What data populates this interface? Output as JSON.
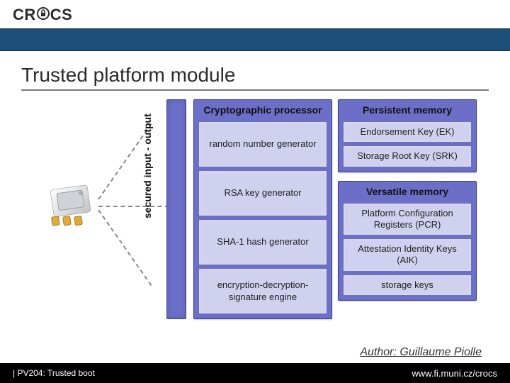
{
  "header": {
    "logo_text": "CRoCS"
  },
  "title": "Trusted platform module",
  "diagram": {
    "io_label": "secured input - output",
    "crypto_processor": {
      "label": "Cryptographic processor",
      "items": [
        "random number generator",
        "RSA key generator",
        "SHA-1 hash generator",
        "encryption-decryption-signature engine"
      ]
    },
    "persistent_memory": {
      "label": "Persistent memory",
      "items": [
        "Endorsement Key (EK)",
        "Storage Root Key (SRK)"
      ]
    },
    "versatile_memory": {
      "label": "Versatile memory",
      "items": [
        "Platform Configuration Registers (PCR)",
        "Attestation Identity Keys (AIK)",
        "storage keys"
      ]
    }
  },
  "author": "Author: Guillaume Piolle",
  "footer": {
    "left": " | PV204: Trusted boot",
    "right": "www.fi.muni.cz/crocs"
  }
}
